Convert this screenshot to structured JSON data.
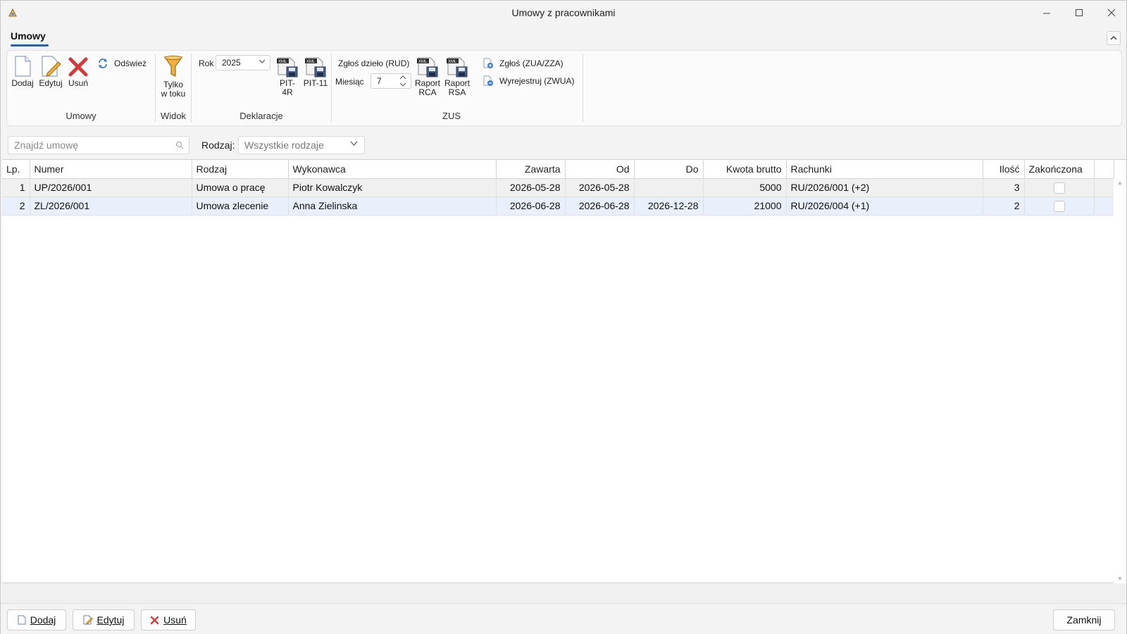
{
  "window": {
    "title": "Umowy z pracownikami"
  },
  "ribbon": {
    "tab_label": "Umowy",
    "groups": {
      "umowy": {
        "label": "Umowy",
        "add_label": "Dodaj",
        "edit_label": "Edytuj",
        "delete_label": "Usuń",
        "refresh_label": "Odśwież"
      },
      "widok": {
        "label": "Widok",
        "filter_label_line1": "Tylko",
        "filter_label_line2": "w toku"
      },
      "deklaracje": {
        "label": "Deklaracje",
        "year_label": "Rok",
        "year_value": "2025",
        "pit4r_label": "PIT-4R",
        "pit11_label": "PIT-11"
      },
      "zus": {
        "label": "ZUS",
        "rud_label": "Zgłoś dzieło (RUD)",
        "month_label": "Miesiąc",
        "month_value": "7",
        "rca_line1": "Raport",
        "rca_line2": "RCA",
        "rsa_line1": "Raport",
        "rsa_line2": "RSA",
        "register_label": "Zgłoś (ZUA/ZZA)",
        "unregister_label": "Wyrejestruj (ZWUA)"
      }
    }
  },
  "filter": {
    "search_placeholder": "Znajdź umowę",
    "type_label": "Rodzaj:",
    "type_value": "Wszystkie rodzaje"
  },
  "table": {
    "columns": [
      "Lp.",
      "Numer",
      "Rodzaj",
      "Wykonawca",
      "Zawarta",
      "Od",
      "Do",
      "Kwota brutto",
      "Rachunki",
      "Ilość",
      "Zakończona"
    ],
    "rows": [
      {
        "lp": "1",
        "numer": "UP/2026/001",
        "rodzaj": "Umowa o pracę",
        "wykonawca": "Piotr Kowalczyk",
        "zawarta": "2026-05-28",
        "od": "2026-05-28",
        "do": "",
        "kwota": "5000",
        "rachunki": "RU/2026/001 (+2)",
        "ilosc": "3",
        "zakonczona": false
      },
      {
        "lp": "2",
        "numer": "ZL/2026/001",
        "rodzaj": "Umowa zlecenie",
        "wykonawca": "Anna Zielinska",
        "zawarta": "2026-06-28",
        "od": "2026-06-28",
        "do": "2026-12-28",
        "kwota": "21000",
        "rachunki": "RU/2026/004 (+1)",
        "ilosc": "2",
        "zakonczona": false
      }
    ]
  },
  "footer": {
    "add_label": "Dodaj",
    "edit_label": "Edytuj",
    "delete_label": "Usuń",
    "close_label": "Zamknij"
  },
  "colors": {
    "accent": "#1f5fbf",
    "selected_row": "#e9f0fb",
    "delete_red": "#d23b3b"
  }
}
